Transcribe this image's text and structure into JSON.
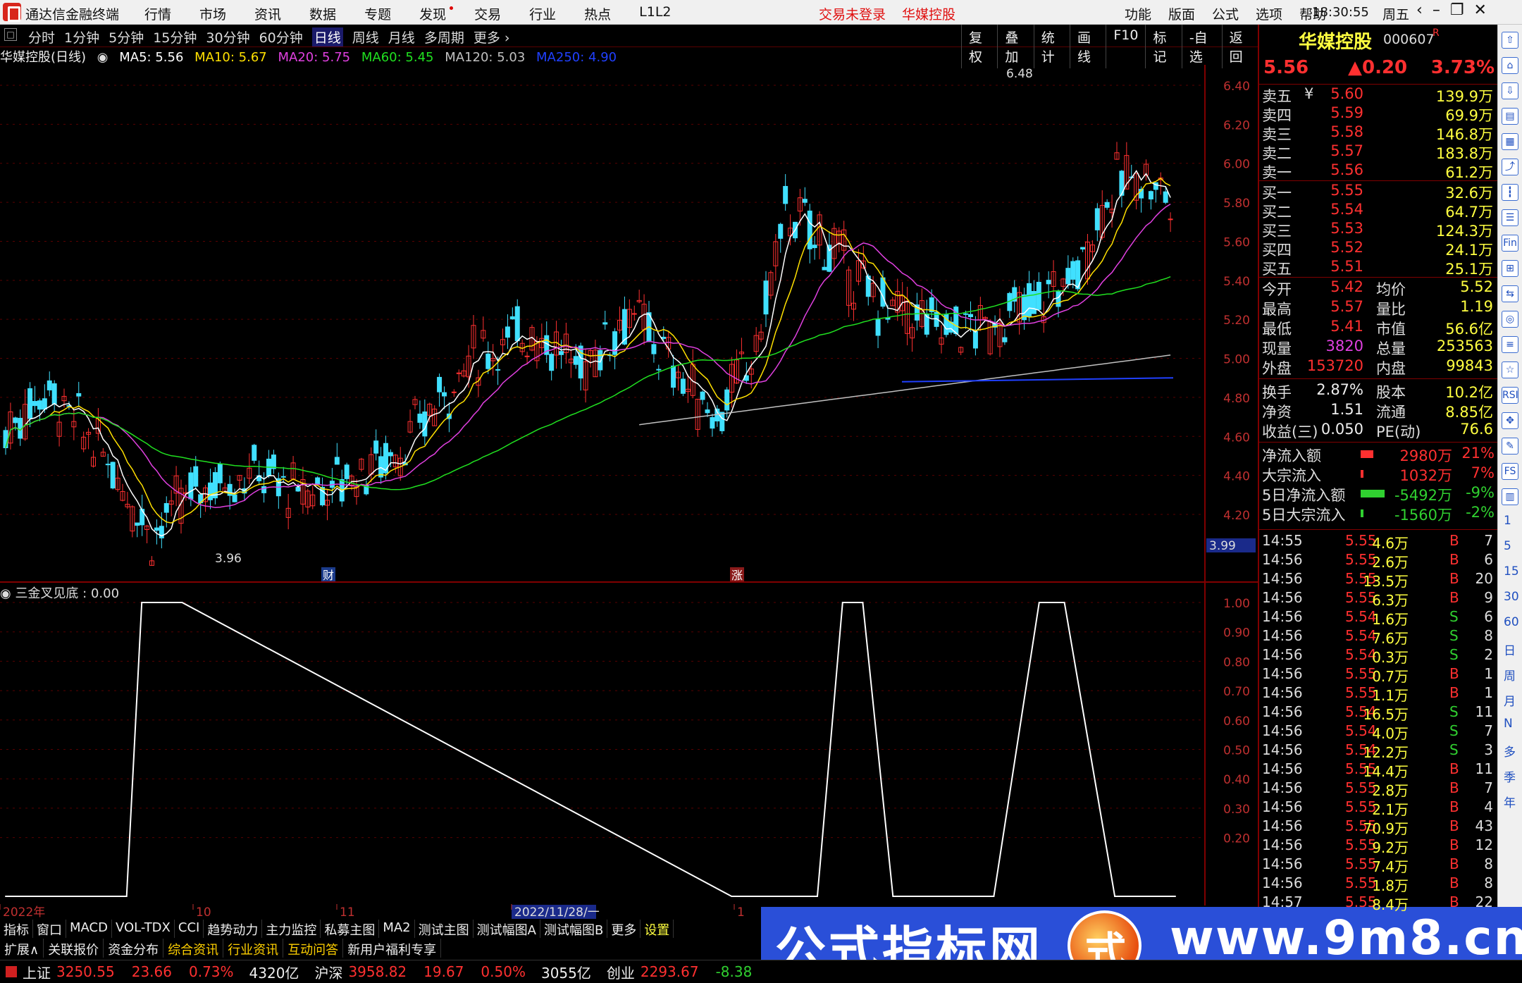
{
  "app": {
    "title": "通达信金融终端",
    "trade_status": "交易未登录",
    "stock_link": "华媒控股",
    "clock": "18:30:55",
    "weekday": "周五"
  },
  "menu": [
    "行情",
    "市场",
    "资讯",
    "数据",
    "专题",
    "发现",
    "交易",
    "行业",
    "热点",
    "L1L2"
  ],
  "right_menu": [
    "功能",
    "版面",
    "公式",
    "选项",
    "帮助"
  ],
  "period_tabs": [
    "分时",
    "1分钟",
    "5分钟",
    "15分钟",
    "30分钟",
    "60分钟",
    "日线",
    "周线",
    "月线",
    "多周期",
    "更多 ›"
  ],
  "active_period": "日线",
  "right_tabs": [
    "复权",
    "叠加",
    "统计",
    "画线",
    "F10",
    "标记",
    "-自选",
    "返回"
  ],
  "infoline": {
    "name": "华媒控股(日线)",
    "ma5": "MA5: 5.56",
    "ma10": "MA10: 5.67",
    "ma20": "MA20: 5.75",
    "ma60": "MA60: 5.45",
    "ma120": "MA120: 5.03",
    "ma250": "MA250: 4.90"
  },
  "colors": {
    "up": "#ff3030",
    "down": "#40e0ff",
    "ma5": "#ffffff",
    "ma10": "#ffe000",
    "ma20": "#e040e0",
    "ma60": "#20e020",
    "ma120": "#c0c0c0",
    "ma250": "#2040ff"
  },
  "main_chart": {
    "y_ticks": [
      "6.40",
      "6.20",
      "6.00",
      "5.80",
      "5.60",
      "5.40",
      "5.20",
      "5.00",
      "4.80",
      "4.60",
      "4.40",
      "4.20"
    ],
    "high_label": "6.48",
    "low_label": "3.96",
    "cursor_price": "3.99",
    "marker1": "财",
    "marker2": "涨"
  },
  "sub_chart": {
    "title": "三金叉见底 : 0.00",
    "y_ticks": [
      "1.00",
      "0.90",
      "0.80",
      "0.70",
      "0.60",
      "0.50",
      "0.40",
      "0.30",
      "0.20"
    ]
  },
  "chart_data": [
    {
      "type": "line",
      "title": "三金叉见底",
      "ylim": [
        0,
        1
      ],
      "x_days": [
        0,
        10,
        18,
        24,
        27,
        35,
        144,
        152,
        161,
        166,
        170,
        176,
        180,
        184,
        196,
        205,
        210,
        220,
        224,
        229,
        232
      ],
      "values": [
        0,
        0,
        0,
        0,
        1,
        1,
        0,
        0,
        0,
        1,
        1,
        0,
        0,
        0,
        0,
        1,
        1,
        0,
        0,
        0,
        0
      ]
    }
  ],
  "date_axis": [
    "2022年",
    "10",
    "11",
    "2022/11/28/一",
    "1"
  ],
  "tool_row1": [
    "指标",
    "窗口",
    "MACD",
    "VOL-TDX",
    "CCI",
    "趋势动力",
    "主力监控",
    "私募主图",
    "MA2",
    "测试主图",
    "测试幅图A",
    "测试幅图B",
    "更多",
    "设置"
  ],
  "tool_row2": [
    "扩展∧",
    "关联报价",
    "资金分布",
    "综合资讯",
    "行业资讯",
    "互动问答",
    "新用户福利专享"
  ],
  "statusbar": {
    "sh_name": "上证",
    "sh_val": "3250.55",
    "sh_chg": "23.66",
    "sh_pct": "0.73%",
    "sh_amt": "4320亿",
    "hs_name": "沪深",
    "hs_val": "3958.82",
    "hs_chg": "19.67",
    "hs_pct": "0.50%",
    "hs_amt": "3055亿",
    "cy_name": "创业",
    "cy_val": "2293.67",
    "cy_chg": "-8.38"
  },
  "watermark": {
    "text": "公式指标网",
    "badge": "式",
    "url": "www.9m8.cn"
  },
  "quote": {
    "name": "华媒控股",
    "code": "000607",
    "flag": "R",
    "price": "5.56",
    "change": "▲0.20",
    "pct": "3.73%",
    "asks": [
      {
        "l": "卖五",
        "p": "5.60",
        "v": "139.9万",
        "m": "¥"
      },
      {
        "l": "卖四",
        "p": "5.59",
        "v": "69.9万"
      },
      {
        "l": "卖三",
        "p": "5.58",
        "v": "146.8万"
      },
      {
        "l": "卖二",
        "p": "5.57",
        "v": "183.8万"
      },
      {
        "l": "卖一",
        "p": "5.56",
        "v": "61.2万"
      }
    ],
    "bids": [
      {
        "l": "买一",
        "p": "5.55",
        "v": "32.6万"
      },
      {
        "l": "买二",
        "p": "5.54",
        "v": "64.7万"
      },
      {
        "l": "买三",
        "p": "5.53",
        "v": "124.3万"
      },
      {
        "l": "买四",
        "p": "5.52",
        "v": "24.1万"
      },
      {
        "l": "买五",
        "p": "5.51",
        "v": "25.1万"
      }
    ],
    "stats": [
      {
        "l1": "今开",
        "v1": "5.42",
        "l2": "均价",
        "v2": "5.52"
      },
      {
        "l1": "最高",
        "v1": "5.57",
        "l2": "量比",
        "v2": "1.19"
      },
      {
        "l1": "最低",
        "v1": "5.41",
        "l2": "市值",
        "v2": "56.6亿"
      },
      {
        "l1": "现量",
        "v1": "3820",
        "l2": "总量",
        "v2": "253563"
      },
      {
        "l1": "外盘",
        "v1": "153720",
        "l2": "内盘",
        "v2": "99843"
      }
    ],
    "stats2": [
      {
        "l1": "换手",
        "v1": "2.87%",
        "l2": "股本",
        "v2": "10.2亿"
      },
      {
        "l1": "净资",
        "v1": "1.51",
        "l2": "流通",
        "v2": "8.85亿"
      },
      {
        "l1": "收益(三)",
        "v1": "0.050",
        "l2": "PE(动)",
        "v2": "76.6"
      }
    ],
    "flows": [
      {
        "l": "净流入额",
        "v": "2980万",
        "p": "21%",
        "bar": 0.5,
        "c": "red"
      },
      {
        "l": "大宗流入",
        "v": "1032万",
        "p": "7%",
        "bar": 0.12,
        "c": "red"
      },
      {
        "l": "5日净流入额",
        "v": "-5492万",
        "p": "-9%",
        "bar": 0.95,
        "c": "grn"
      },
      {
        "l": "5日大宗流入",
        "v": "-1560万",
        "p": "-2%",
        "bar": 0.12,
        "c": "grn"
      }
    ],
    "ticks": [
      {
        "t": "14:55",
        "p": "5.55",
        "v": "4.6万",
        "d": "B",
        "n": "7"
      },
      {
        "t": "14:56",
        "p": "5.55",
        "v": "2.6万",
        "d": "B",
        "n": "6"
      },
      {
        "t": "14:56",
        "p": "5.55",
        "v": "13.5万",
        "d": "B",
        "n": "20"
      },
      {
        "t": "14:56",
        "p": "5.55",
        "v": "6.3万",
        "d": "B",
        "n": "9"
      },
      {
        "t": "14:56",
        "p": "5.54",
        "v": "1.6万",
        "d": "S",
        "n": "6"
      },
      {
        "t": "14:56",
        "p": "5.54",
        "v": "7.6万",
        "d": "S",
        "n": "8"
      },
      {
        "t": "14:56",
        "p": "5.54",
        "v": "0.3万",
        "d": "S",
        "n": "2"
      },
      {
        "t": "14:56",
        "p": "5.55",
        "v": "0.7万",
        "d": "B",
        "n": "1"
      },
      {
        "t": "14:56",
        "p": "5.55",
        "v": "1.1万",
        "d": "B",
        "n": "1"
      },
      {
        "t": "14:56",
        "p": "5.54",
        "v": "16.5万",
        "d": "S",
        "n": "11"
      },
      {
        "t": "14:56",
        "p": "5.54",
        "v": "4.0万",
        "d": "S",
        "n": "7"
      },
      {
        "t": "14:56",
        "p": "5.54",
        "v": "12.2万",
        "d": "S",
        "n": "3"
      },
      {
        "t": "14:56",
        "p": "5.55",
        "v": "14.4万",
        "d": "B",
        "n": "11"
      },
      {
        "t": "14:56",
        "p": "5.55",
        "v": "2.8万",
        "d": "B",
        "n": "7"
      },
      {
        "t": "14:56",
        "p": "5.55",
        "v": "2.1万",
        "d": "B",
        "n": "4"
      },
      {
        "t": "14:56",
        "p": "5.55",
        "v": "70.9万",
        "d": "B",
        "n": "43"
      },
      {
        "t": "14:56",
        "p": "5.55",
        "v": "9.2万",
        "d": "B",
        "n": "12"
      },
      {
        "t": "14:56",
        "p": "5.55",
        "v": "7.4万",
        "d": "B",
        "n": "8"
      },
      {
        "t": "14:56",
        "p": "5.55",
        "v": "1.8万",
        "d": "B",
        "n": "8"
      },
      {
        "t": "14:57",
        "p": "5.55",
        "v": "8.4万",
        "d": "B",
        "n": "22"
      }
    ]
  },
  "side_icons": [
    "up-arrow",
    "home",
    "down-arrow",
    "doc",
    "grid",
    "chart",
    "kline",
    "table",
    "fin",
    "map",
    "compare",
    "web",
    "list",
    "star",
    "RSI",
    "move",
    "pen",
    "FS",
    "bars",
    "1",
    "5",
    "15",
    "30",
    "60",
    "日",
    "周",
    "月",
    "N",
    "多",
    "季",
    "年"
  ]
}
